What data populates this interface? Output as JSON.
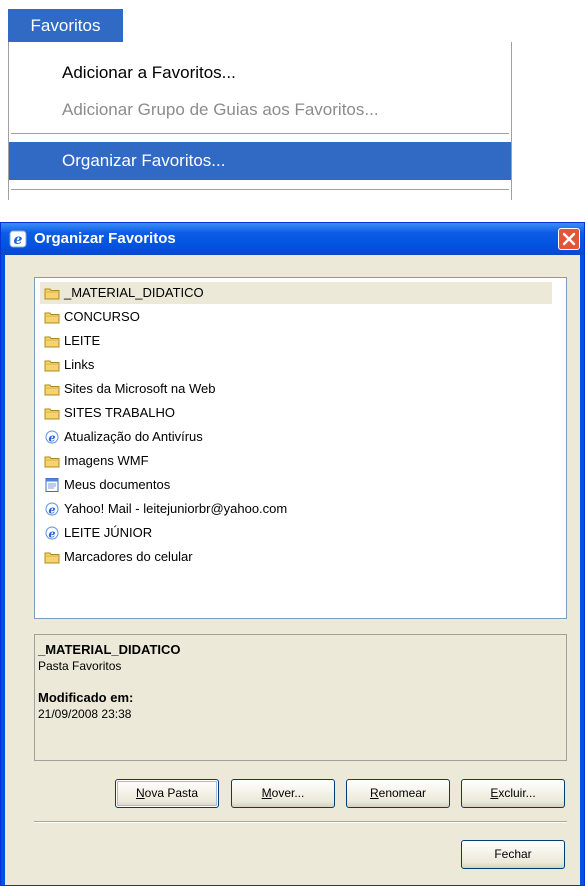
{
  "menu": {
    "title": "Favoritos",
    "items": [
      {
        "label": "Adicionar a Favoritos...",
        "state": "normal"
      },
      {
        "label": "Adicionar Grupo de Guias aos Favoritos...",
        "state": "disabled"
      },
      {
        "label": "Organizar Favoritos...",
        "state": "selected"
      }
    ]
  },
  "dialog": {
    "title": "Organizar Favoritos",
    "list": [
      {
        "label": "_MATERIAL_DIDATICO",
        "icon": "folder-icon",
        "selected": true
      },
      {
        "label": "CONCURSO",
        "icon": "folder-icon"
      },
      {
        "label": "LEITE",
        "icon": "folder-icon"
      },
      {
        "label": "Links",
        "icon": "folder-icon"
      },
      {
        "label": "Sites da Microsoft na Web",
        "icon": "folder-icon"
      },
      {
        "label": "SITES TRABALHO",
        "icon": "folder-icon"
      },
      {
        "label": "Atualização do Antivírus",
        "icon": "ie-link-icon"
      },
      {
        "label": "Imagens WMF",
        "icon": "folder-icon"
      },
      {
        "label": "Meus documentos",
        "icon": "document-icon"
      },
      {
        "label": "Yahoo! Mail - leitejuniorbr@yahoo.com",
        "icon": "ie-link-icon"
      },
      {
        "label": "LEITE JÚNIOR",
        "icon": "ie-link-icon"
      },
      {
        "label": "Marcadores do celular",
        "icon": "folder-icon"
      }
    ],
    "info": {
      "name": "_MATERIAL_DIDATICO",
      "type": "Pasta Favoritos",
      "modified_label": "Modificado em:",
      "modified_value": "21/09/2008 23:38"
    },
    "buttons": {
      "new_folder": {
        "accel": "N",
        "rest": "ova Pasta"
      },
      "move": {
        "accel": "M",
        "rest": "over..."
      },
      "rename": {
        "accel": "R",
        "rest": "enomear"
      },
      "delete": {
        "accel": "E",
        "rest": "xcluir..."
      },
      "close": "Fechar"
    }
  },
  "colors": {
    "selection": "#316ac5",
    "title_bar": "#0053e0",
    "dialog_bg": "#ece9d8"
  }
}
